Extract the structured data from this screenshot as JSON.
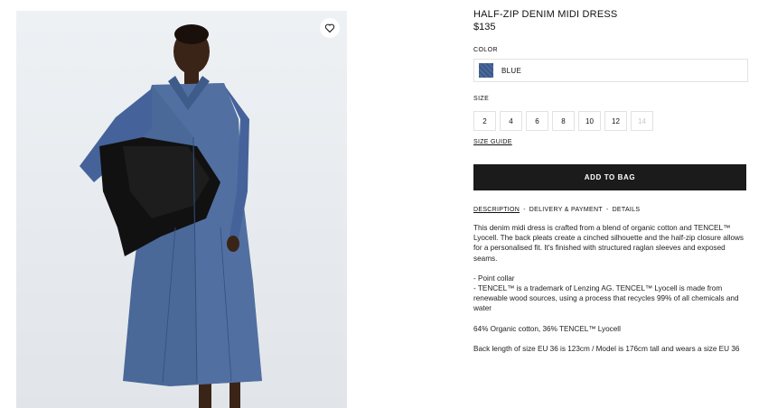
{
  "product": {
    "title": "HALF-ZIP DENIM MIDI DRESS",
    "price": "$135"
  },
  "color": {
    "label": "COLOR",
    "selected": "BLUE",
    "swatch_hex": "#3f5c8f"
  },
  "size": {
    "label": "SIZE",
    "options": [
      "2",
      "4",
      "6",
      "8",
      "10",
      "12",
      "14"
    ],
    "unavailable": [
      "14"
    ],
    "guide_label": "SIZE GUIDE"
  },
  "actions": {
    "add_to_bag": "ADD TO BAG"
  },
  "tabs": {
    "description": "DESCRIPTION",
    "delivery": "DELIVERY & PAYMENT",
    "details": "DETAILS",
    "separator": "-"
  },
  "description": {
    "paragraph": "This denim midi dress is crafted from a blend of organic cotton and TENCEL™ Lyocell. The back pleats create a cinched silhouette and the half-zip closure allows for a personalised fit. It's finished with structured raglan sleeves and exposed seams.",
    "bullet_1": "- Point collar",
    "bullet_2": "- TENCEL™ is a trademark of Lenzing AG. TENCEL™ Lyocell is made from renewable wood sources, using a process that recycles 99% of all chemicals and water",
    "composition": "64% Organic cotton, 36% TENCEL™ Lyocell",
    "fit": "Back length of size EU 36 is 123cm / Model is 176cm tall and wears a size EU 36"
  },
  "icons": {
    "wishlist": "heart-icon"
  },
  "colors": {
    "button_bg": "#1b1b1b",
    "border": "#e2e2e2",
    "denim": "#3f5c8f"
  }
}
